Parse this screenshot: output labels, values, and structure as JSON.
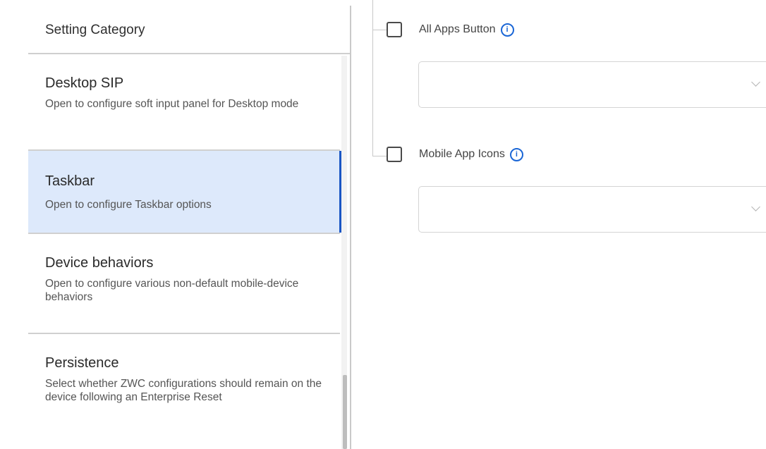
{
  "sidebar": {
    "header": "Setting Category",
    "items": [
      {
        "title": "Desktop SIP",
        "desc": "Open to configure soft input panel for Desktop mode",
        "selected": false
      },
      {
        "title": "Taskbar",
        "desc": "Open to configure Taskbar options",
        "selected": true
      },
      {
        "title": "Device behaviors",
        "desc": "Open to configure various non-default mobile-device behaviors",
        "selected": false
      },
      {
        "title": "Persistence",
        "desc": "Select whether ZWC configurations should remain on the device following an Enterprise Reset",
        "selected": false
      }
    ]
  },
  "options": [
    {
      "label": "All Apps Button",
      "checked": false,
      "select_value": ""
    },
    {
      "label": "Mobile App Icons",
      "checked": false,
      "select_value": ""
    }
  ],
  "colors": {
    "selected_bg": "#dde9fb",
    "selected_accent": "#1a56c4",
    "info_icon": "#1a66d6"
  },
  "icons": {
    "info": "info-icon",
    "dropdown": "chevron-down-icon"
  }
}
